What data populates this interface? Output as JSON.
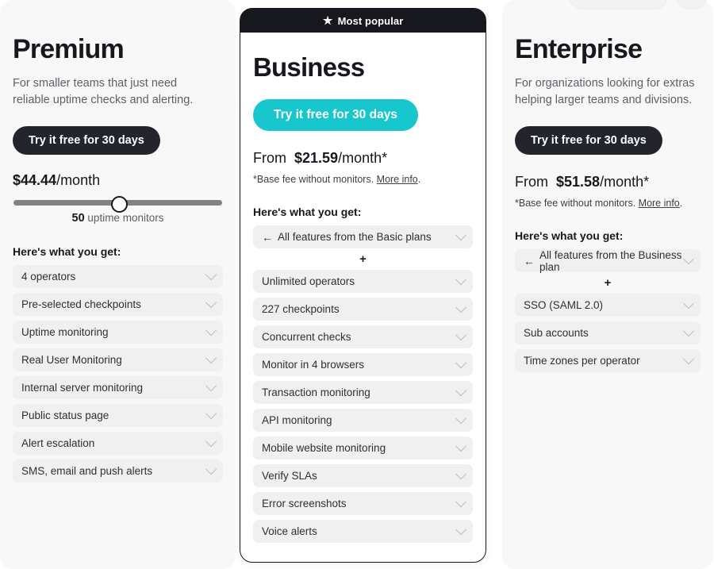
{
  "colors": {
    "accent_teal": "#18c6ce",
    "dark": "#16181d",
    "card_bg": "#f8f8f8",
    "feature_bg": "#f0f0f1",
    "page_bg": "#ffffff"
  },
  "plans": {
    "premium": {
      "title": "Premium",
      "description": "For smaller teams that just need reliable uptime checks and alerting.",
      "cta_label": "Try it free for 30 days",
      "price": "$44.44",
      "price_suffix": "/month",
      "slider": {
        "value": "50",
        "unit": "uptime monitors",
        "percent": 50
      },
      "features_heading": "Here's what you get:",
      "features": [
        "4 operators",
        "Pre-selected checkpoints",
        "Uptime monitoring",
        "Real User Monitoring",
        "Internal server monitoring",
        "Public status page",
        "Alert escalation",
        "SMS, email and push alerts"
      ]
    },
    "business": {
      "badge_label": "Most popular",
      "badge_icon": "star-icon",
      "title": "Business",
      "cta_label": "Try it free for 30 days",
      "price_prefix": "From",
      "price": "$21.59",
      "price_suffix": "/month*",
      "footnote_text": "*Base fee without monitors.",
      "footnote_link": "More info",
      "footnote_end": ".",
      "features_heading": "Here's what you get:",
      "inherited_feature": "All features from the Basic plans",
      "inherited_arrow": "←",
      "plus_divider": "+",
      "features": [
        "Unlimited operators",
        "227 checkpoints",
        "Concurrent checks",
        "Monitor in 4 browsers",
        "Transaction monitoring",
        "API monitoring",
        "Mobile website monitoring",
        "Verify SLAs",
        "Error screenshots",
        "Voice alerts"
      ]
    },
    "enterprise": {
      "title": "Enterprise",
      "description": "For organizations looking for extras helping larger teams and divisions.",
      "cta_label": "Try it free for 30 days",
      "price_prefix": "From",
      "price": "$51.58",
      "price_suffix": "/month*",
      "footnote_text": "*Base fee without monitors.",
      "footnote_link": "More info",
      "footnote_end": ".",
      "features_heading": "Here's what you get:",
      "inherited_feature": "All features from the Business plan",
      "inherited_arrow": "←",
      "plus_divider": "+",
      "features": [
        "SSO (SAML 2.0)",
        "Sub accounts",
        "Time zones per operator"
      ]
    }
  }
}
